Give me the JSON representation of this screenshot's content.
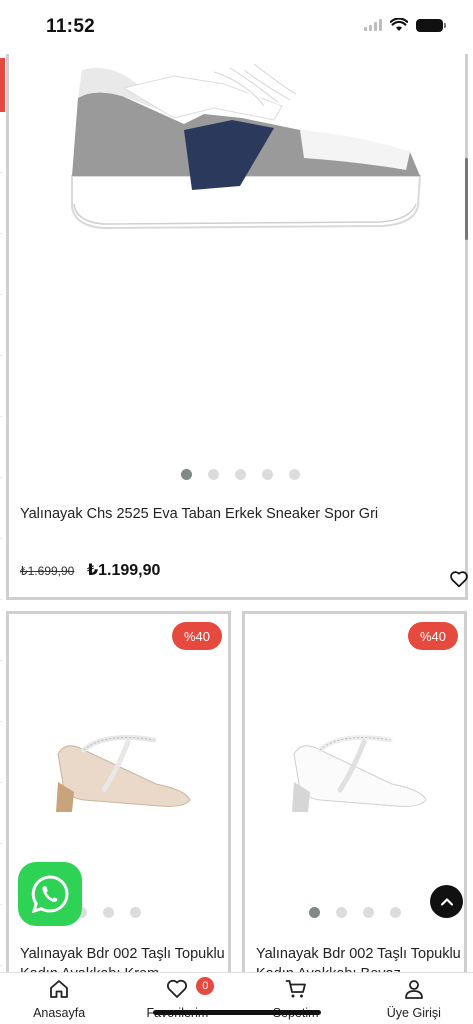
{
  "status_bar": {
    "time": "11:52"
  },
  "featured_product": {
    "title": "Yalınayak Chs 2525 Eva Taban Erkek Sneaker Spor Gri",
    "old_price": "₺1.699,90",
    "price": "₺1.199,90",
    "image_count": 5,
    "active_image": 1
  },
  "products": [
    {
      "badge": "%40",
      "title": "Yalınayak Bdr 002 Taşlı Topuklu Kadın Ayakkabı Krem",
      "image_count": 4,
      "active_image": 1
    },
    {
      "badge": "%40",
      "title": "Yalınayak Bdr 002 Taşlı Topuklu Kadın Ayakkabı Beyaz",
      "image_count": 4,
      "active_image": 1
    }
  ],
  "bottom_nav": {
    "items": [
      {
        "label": "Anasayfa",
        "icon": "home-icon"
      },
      {
        "label": "Favorilerim",
        "icon": "heart-icon",
        "badge": "0"
      },
      {
        "label": "Sepetim",
        "icon": "cart-icon"
      },
      {
        "label": "Üye Girişi",
        "icon": "user-icon"
      }
    ]
  },
  "colors": {
    "accent": "#e64a3f",
    "whatsapp": "#2ed254",
    "dot_active": "#7d8a85",
    "dot_inactive": "#dcdcdc"
  }
}
